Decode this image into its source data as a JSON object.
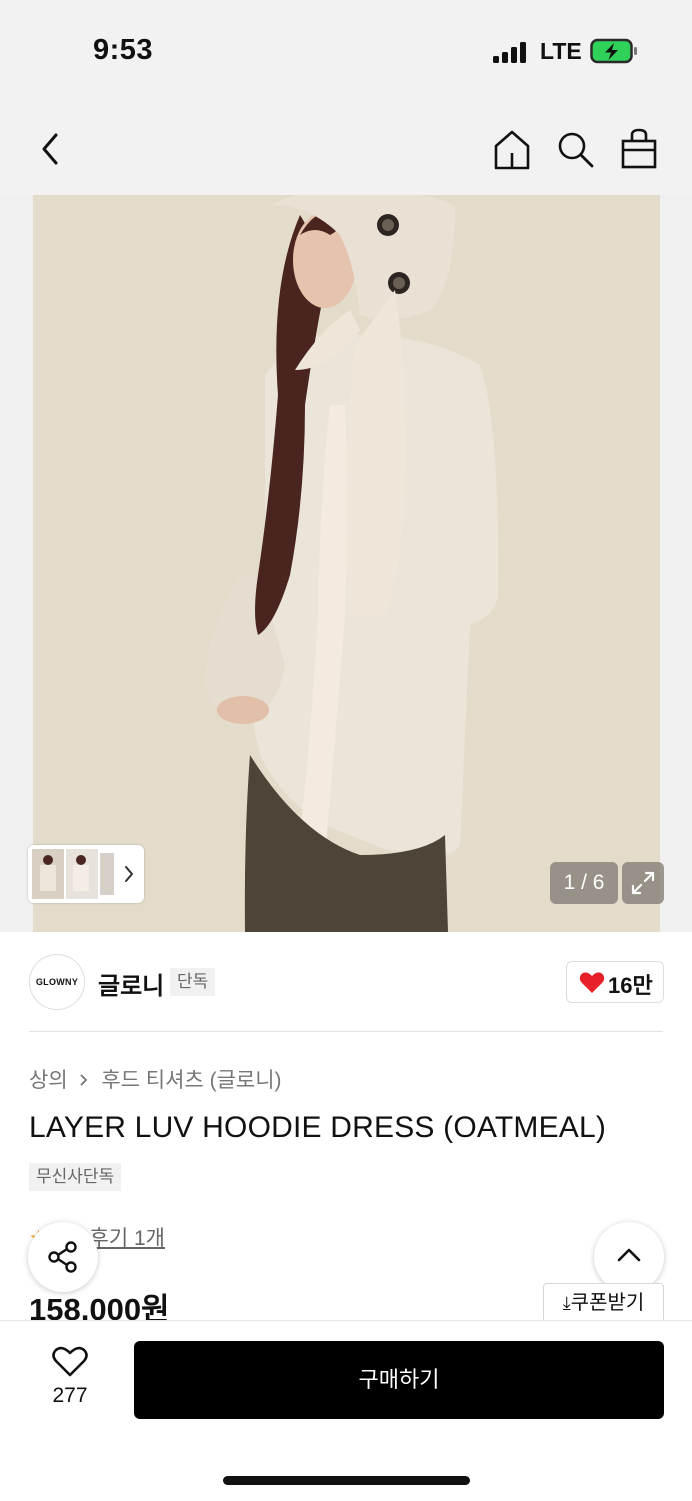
{
  "status_bar": {
    "time": "9:53",
    "carrier": "LTE"
  },
  "nav": {
    "back_icon": "chevron-left-icon",
    "home_icon": "home-icon",
    "search_icon": "search-icon",
    "cart_icon": "shopping-bag-icon"
  },
  "gallery": {
    "page_indicator": "1 / 6",
    "expand_icon": "expand-icon"
  },
  "brand": {
    "logo_text": "GLOWNY",
    "name": "글로니",
    "badge": "단독",
    "like_count": "16만"
  },
  "product": {
    "category_main": "상의",
    "category_sub": "후드 티셔츠 (글로니)",
    "title": "LAYER LUV HOODIE DRESS (OATMEAL)",
    "exclusive_tag": "무신사단독",
    "review_text": "후기 1개",
    "price": "158,000원"
  },
  "coupon": {
    "label": "쿠폰받기"
  },
  "bottom_bar": {
    "wish_count": "277",
    "buy_label": "구매하기"
  },
  "colors": {
    "accent_red": "#e8202a",
    "battery_green": "#30d158",
    "buy_button": "#000000"
  }
}
